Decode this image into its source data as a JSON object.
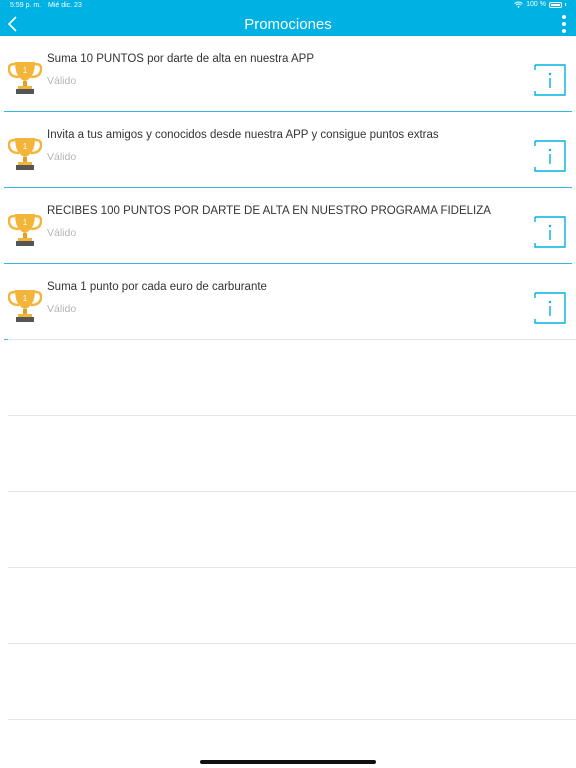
{
  "status": {
    "time": "5:59 p. m.",
    "date": "Mié dic. 23",
    "battery": "100 %"
  },
  "header": {
    "title": "Promociones"
  },
  "promotions": [
    {
      "title": "Suma 10 PUNTOS por darte de alta en nuestra APP",
      "status": "Válido"
    },
    {
      "title": "Invita a tus amigos y conocidos desde nuestra APP y consigue puntos extras",
      "status": "Válido"
    },
    {
      "title": "RECIBES 100 PUNTOS POR DARTE DE ALTA EN NUESTRO PROGRAMA FIDELIZA",
      "status": "Válido"
    },
    {
      "title": "Suma 1 punto por cada euro de carburante",
      "status": "Válido"
    }
  ],
  "colors": {
    "accent": "#00b1e3",
    "divider": "#35b6e0",
    "trophy_gold": "#f3b43a",
    "muted_text": "#b5b5b5"
  }
}
